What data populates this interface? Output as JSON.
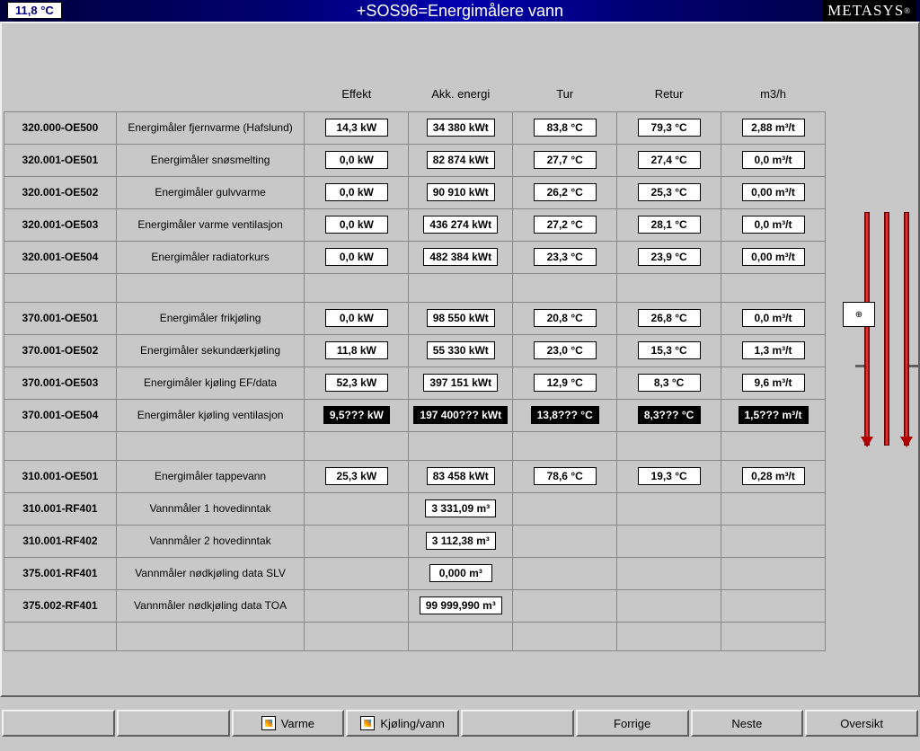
{
  "header": {
    "outdoor_temp": "11,8 °C",
    "title": "+SOS96=Energimålere vann",
    "brand": "METASYS"
  },
  "columns": [
    "Effekt",
    "Akk. energi",
    "Tur",
    "Retur",
    "m3/h"
  ],
  "rows": [
    {
      "id": "320.000-OE500",
      "desc": "Energimåler fjernvarme (Hafslund)",
      "effekt": "14,3 kW",
      "akk": "34 380 kWt",
      "tur": "83,8 °C",
      "retur": "79,3 °C",
      "flow": "2,88 m³/t"
    },
    {
      "id": "320.001-OE501",
      "desc": "Energimåler snøsmelting",
      "effekt": "0,0 kW",
      "akk": "82 874 kWt",
      "tur": "27,7 °C",
      "retur": "27,4 °C",
      "flow": "0,0 m³/t"
    },
    {
      "id": "320.001-OE502",
      "desc": "Energimåler gulvvarme",
      "effekt": "0,0 kW",
      "akk": "90 910 kWt",
      "tur": "26,2 °C",
      "retur": "25,3 °C",
      "flow": "0,00 m³/t"
    },
    {
      "id": "320.001-OE503",
      "desc": "Energimåler varme ventilasjon",
      "effekt": "0,0 kW",
      "akk": "436 274 kWt",
      "tur": "27,2 °C",
      "retur": "28,1 °C",
      "flow": "0,0 m³/t"
    },
    {
      "id": "320.001-OE504",
      "desc": "Energimåler radiatorkurs",
      "effekt": "0,0 kW",
      "akk": "482 384 kWt",
      "tur": "23,3 °C",
      "retur": "23,9 °C",
      "flow": "0,00 m³/t"
    },
    {
      "spacer": true
    },
    {
      "id": "370.001-OE501",
      "desc": "Energimåler frikjøling",
      "effekt": "0,0 kW",
      "akk": "98 550 kWt",
      "tur": "20,8 °C",
      "retur": "26,8 °C",
      "flow": "0,0 m³/t"
    },
    {
      "id": "370.001-OE502",
      "desc": "Energimåler sekundærkjøling",
      "effekt": "11,8 kW",
      "akk": "55 330 kWt",
      "tur": "23,0 °C",
      "retur": "15,3 °C",
      "flow": "1,3 m³/t"
    },
    {
      "id": "370.001-OE503",
      "desc": "Energimåler kjøling EF/data",
      "effekt": "52,3 kW",
      "akk": "397 151 kWt",
      "tur": "12,9 °C",
      "retur": "8,3 °C",
      "flow": "9,6 m³/t"
    },
    {
      "id": "370.001-OE504",
      "desc": "Energimåler kjøling ventilasjon",
      "effekt": "9,5??? kW",
      "akk": "197 400??? kWt",
      "tur": "13,8??? °C",
      "retur": "8,3??? °C",
      "flow": "1,5??? m³/t",
      "alarm": true
    },
    {
      "spacer": true
    },
    {
      "id": "310.001-OE501",
      "desc": "Energimåler tappevann",
      "effekt": "25,3 kW",
      "akk": "83 458 kWt",
      "tur": "78,6 °C",
      "retur": "19,3 °C",
      "flow": "0,28 m³/t"
    },
    {
      "id": "310.001-RF401",
      "desc": "Vannmåler 1 hovedinntak",
      "akk": "3 331,09 m³"
    },
    {
      "id": "310.001-RF402",
      "desc": "Vannmåler 2 hovedinntak",
      "akk": "3 112,38 m³"
    },
    {
      "id": "375.001-RF401",
      "desc": "Vannmåler nødkjøling data SLV",
      "akk": "0,000 m³"
    },
    {
      "id": "375.002-RF401",
      "desc": "Vannmåler nødkjøling data TOA",
      "akk": "99 999,990 m³"
    },
    {
      "spacer": true
    }
  ],
  "buttons": {
    "varme": "Varme",
    "kjoling": "Kjøling/vann",
    "forrige": "Forrige",
    "neste": "Neste",
    "oversikt": "Oversikt"
  },
  "gauge_symbol": "⊕"
}
